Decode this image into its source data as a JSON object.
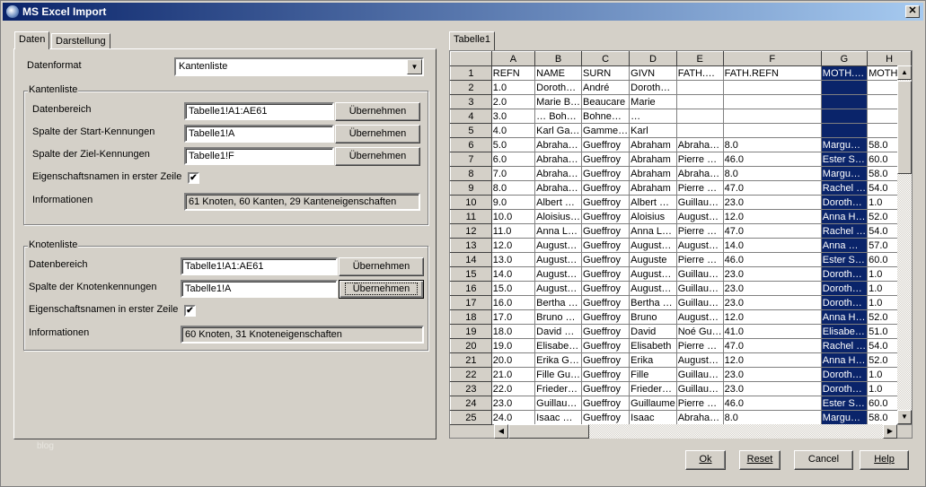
{
  "window": {
    "title": "MS Excel Import",
    "close": "✕"
  },
  "left": {
    "tabs": [
      "Daten",
      "Darstellung"
    ],
    "datenformat_label": "Datenformat",
    "datenformat_value": "Kantenliste",
    "kanten": {
      "title": "Kantenliste",
      "datenbereich_label": "Datenbereich",
      "datenbereich_value": "Tabelle1!A1:AE61",
      "start_label": "Spalte der Start-Kennungen",
      "start_value": "Tabelle1!A",
      "ziel_label": "Spalte der Ziel-Kennungen",
      "ziel_value": "Tabelle1!F",
      "header_label": "Eigenschaftsnamen in erster Zeile",
      "header_checked": true,
      "info_label": "Informationen",
      "info_value": "61 Knoten, 60 Kanten, 29 Kanteneigenschaften"
    },
    "knoten": {
      "title": "Knotenliste",
      "datenbereich_label": "Datenbereich",
      "datenbereich_value": "Tabelle1!A1:AE61",
      "id_label": "Spalte der Knotenkennungen",
      "id_value": "Tabelle1!A",
      "header_label": "Eigenschaftsnamen in erster Zeile",
      "header_checked": true,
      "info_label": "Informationen",
      "info_value": "60 Knoten, 31 Knoteneigenschaften"
    },
    "apply_label": "Übernehmen"
  },
  "right": {
    "tab": "Tabelle1",
    "columns": [
      "A",
      "B",
      "C",
      "D",
      "E",
      "F",
      "G",
      "H"
    ],
    "selected_column": "G",
    "rows": [
      [
        "1",
        "REFN",
        "NAME",
        "SURN",
        "GIVN",
        "FATH.…",
        "FATH.REFN",
        "MOTH.…",
        "MOTH."
      ],
      [
        "2",
        "1.0",
        "Doroth…",
        "André",
        "Doroth…",
        "",
        "",
        "",
        ""
      ],
      [
        "3",
        "2.0",
        "Marie B…",
        "Beaucare",
        "Marie",
        "",
        "",
        "",
        ""
      ],
      [
        "4",
        "3.0",
        "… Boh…",
        "Bohne…",
        "…",
        "",
        "",
        "",
        ""
      ],
      [
        "5",
        "4.0",
        "Karl Ga…",
        "Gamme…",
        "Karl",
        "",
        "",
        "",
        ""
      ],
      [
        "6",
        "5.0",
        "Abraha…",
        "Gueffroy",
        "Abraham",
        "Abraha…",
        "8.0",
        "Margu…",
        "58.0"
      ],
      [
        "7",
        "6.0",
        "Abraha…",
        "Gueffroy",
        "Abraham",
        "Pierre …",
        "46.0",
        "Ester S…",
        "60.0"
      ],
      [
        "8",
        "7.0",
        "Abraha…",
        "Gueffroy",
        "Abraham",
        "Abraha…",
        "8.0",
        "Margu…",
        "58.0"
      ],
      [
        "9",
        "8.0",
        "Abraha…",
        "Gueffroy",
        "Abraham",
        "Pierre …",
        "47.0",
        "Rachel …",
        "54.0"
      ],
      [
        "10",
        "9.0",
        "Albert …",
        "Gueffroy",
        "Albert …",
        "Guillau…",
        "23.0",
        "Doroth…",
        "1.0"
      ],
      [
        "11",
        "10.0",
        "Aloisius…",
        "Gueffroy",
        "Aloisius",
        "August…",
        "12.0",
        "Anna H…",
        "52.0"
      ],
      [
        "12",
        "11.0",
        "Anna L…",
        "Gueffroy",
        "Anna L…",
        "Pierre …",
        "47.0",
        "Rachel …",
        "54.0"
      ],
      [
        "13",
        "12.0",
        "August…",
        "Gueffroy",
        "August…",
        "August…",
        "14.0",
        "Anna …",
        "57.0"
      ],
      [
        "14",
        "13.0",
        "August…",
        "Gueffroy",
        "Auguste",
        "Pierre …",
        "46.0",
        "Ester S…",
        "60.0"
      ],
      [
        "15",
        "14.0",
        "August…",
        "Gueffroy",
        "August…",
        "Guillau…",
        "23.0",
        "Doroth…",
        "1.0"
      ],
      [
        "16",
        "15.0",
        "August…",
        "Gueffroy",
        "August…",
        "Guillau…",
        "23.0",
        "Doroth…",
        "1.0"
      ],
      [
        "17",
        "16.0",
        "Bertha …",
        "Gueffroy",
        "Bertha …",
        "Guillau…",
        "23.0",
        "Doroth…",
        "1.0"
      ],
      [
        "18",
        "17.0",
        "Bruno …",
        "Gueffroy",
        "Bruno",
        "August…",
        "12.0",
        "Anna H…",
        "52.0"
      ],
      [
        "19",
        "18.0",
        "David …",
        "Gueffroy",
        "David",
        "Noé Gu…",
        "41.0",
        "Elisabe…",
        "51.0"
      ],
      [
        "20",
        "19.0",
        "Elisabe…",
        "Gueffroy",
        "Elisabeth",
        "Pierre …",
        "47.0",
        "Rachel …",
        "54.0"
      ],
      [
        "21",
        "20.0",
        "Erika G…",
        "Gueffroy",
        "Erika",
        "August…",
        "12.0",
        "Anna H…",
        "52.0"
      ],
      [
        "22",
        "21.0",
        "Fille Gu…",
        "Gueffroy",
        "Fille",
        "Guillau…",
        "23.0",
        "Doroth…",
        "1.0"
      ],
      [
        "23",
        "22.0",
        "Frieder…",
        "Gueffroy",
        "Frieder…",
        "Guillau…",
        "23.0",
        "Doroth…",
        "1.0"
      ],
      [
        "24",
        "23.0",
        "Guillau…",
        "Gueffroy",
        "Guillaume",
        "Pierre …",
        "46.0",
        "Ester S…",
        "60.0"
      ],
      [
        "25",
        "24.0",
        "Isaac …",
        "Gueffroy",
        "Isaac",
        "Abraha…",
        "8.0",
        "Margu…",
        "58.0"
      ]
    ]
  },
  "footer": {
    "ok": "Ok",
    "reset": "Reset",
    "cancel": "Cancel",
    "help": "Help",
    "watermark": "blog"
  }
}
